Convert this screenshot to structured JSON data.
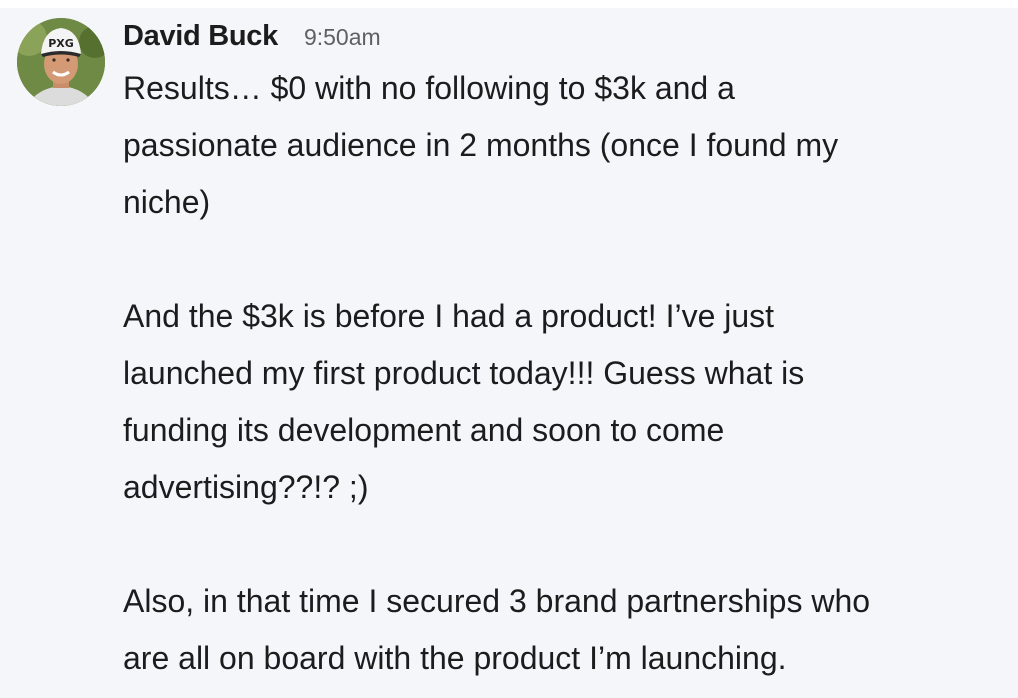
{
  "message": {
    "author": "David Buck",
    "timestamp": "9:50am",
    "paragraphs": [
      {
        "lines": [
          "Results… $0 with no following to $3k and a",
          "passionate audience in 2 months (once I found my",
          "niche)"
        ]
      },
      {
        "lines": [
          "And the $3k is before I had a product! I’ve just",
          "launched my first product today!!! Guess what is",
          "funding its development and soon to come",
          "advertising??!? ;)"
        ]
      },
      {
        "lines": [
          "Also, in that time I secured 3 brand partnerships who",
          "are all on board with the product I’m launching."
        ]
      }
    ]
  },
  "avatar": {
    "cap_logo": "PXG"
  },
  "colors": {
    "message_bg": "#f5f6fa",
    "text": "#1d1c1d",
    "timestamp": "#616061"
  }
}
